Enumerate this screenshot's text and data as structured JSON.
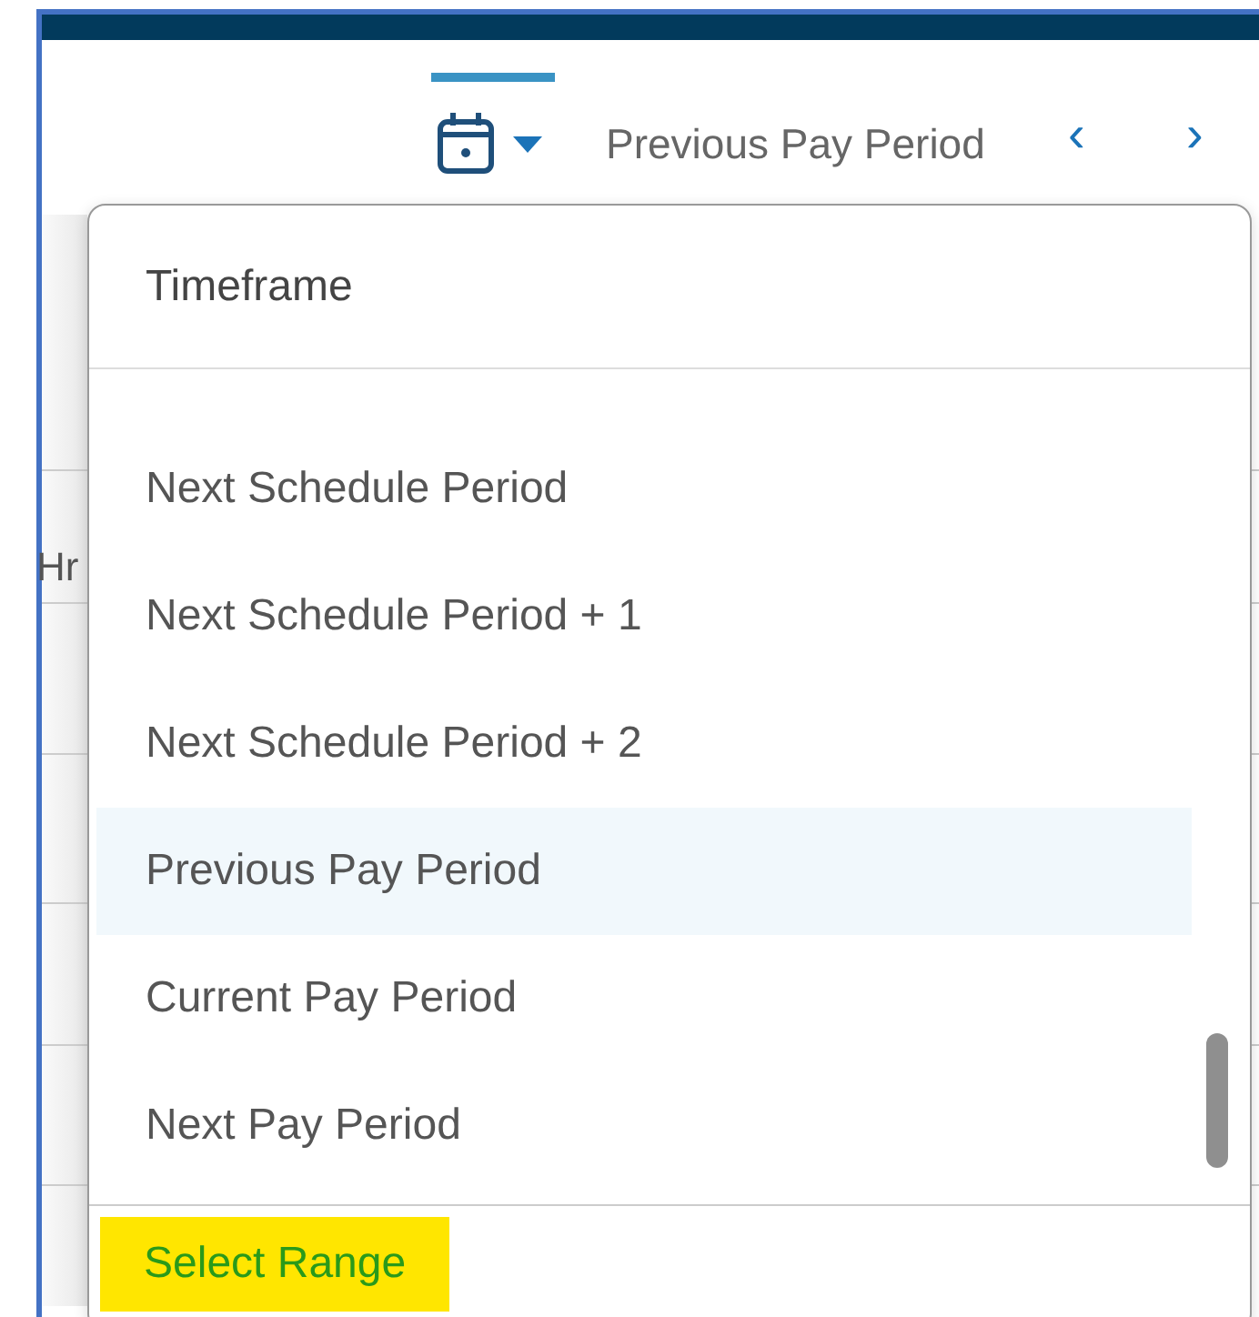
{
  "toolbar": {
    "calendar_selected": true,
    "period_label": "Previous Pay Period",
    "prev": "‹",
    "next": "›"
  },
  "background_table": {
    "header_fragment": "Hr"
  },
  "dropdown": {
    "title": "Timeframe",
    "items": [
      {
        "label": "Next Schedule Period",
        "selected": false
      },
      {
        "label": "Next Schedule Period + 1",
        "selected": false
      },
      {
        "label": "Next Schedule Period + 2",
        "selected": false
      },
      {
        "label": "Previous Pay Period",
        "selected": true
      },
      {
        "label": "Current Pay Period",
        "selected": false
      },
      {
        "label": "Next Pay Period",
        "selected": false
      }
    ],
    "footer": {
      "label": "Select Range",
      "highlighted": true
    }
  }
}
